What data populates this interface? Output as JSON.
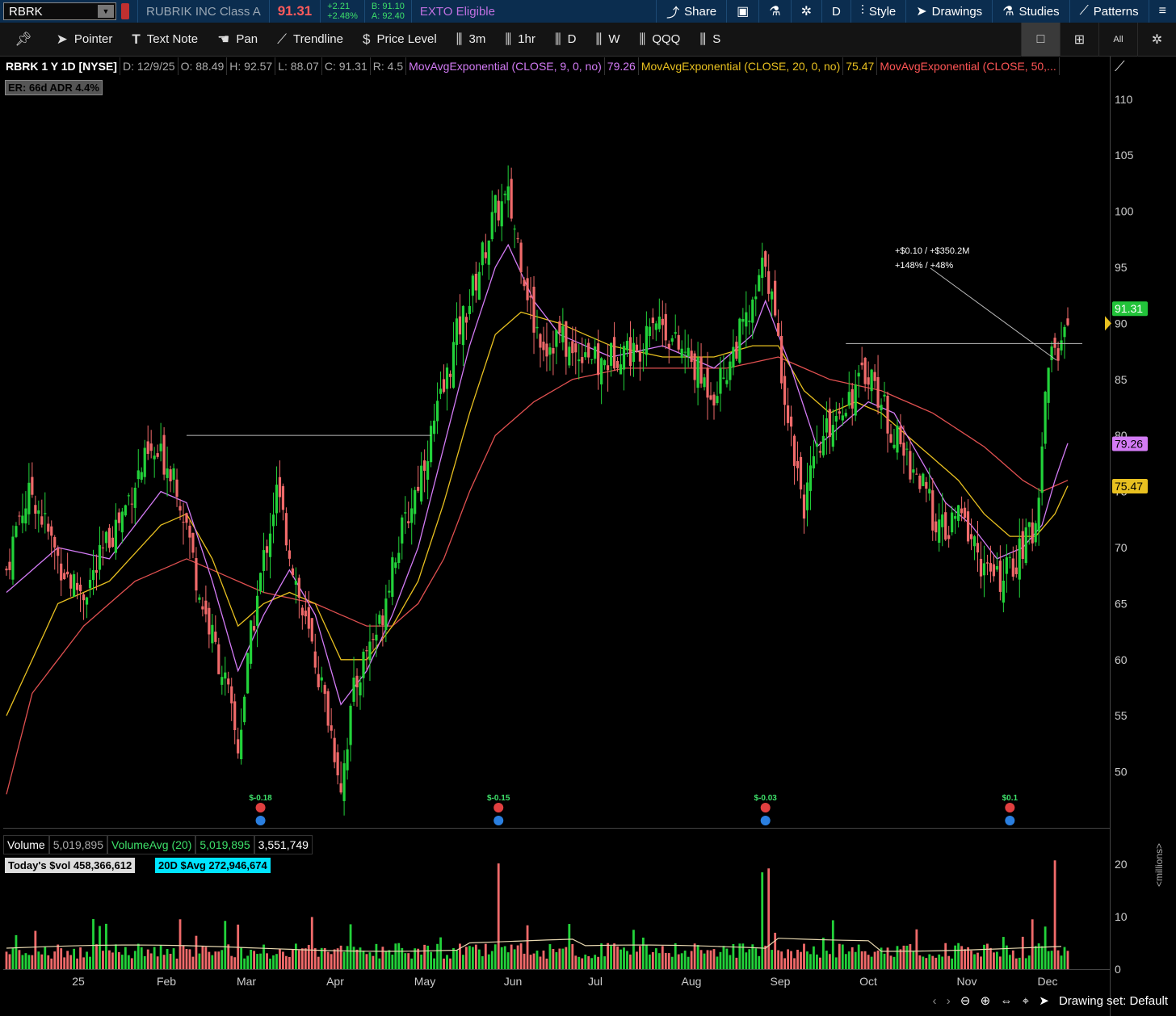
{
  "topbar": {
    "symbol": "RBRK",
    "company": "RUBRIK INC Class A",
    "last": "91.31",
    "change": "+2.21",
    "change_pct": "+2.48%",
    "bid": "B: 91.10",
    "ask": "A: 92.40",
    "exto": "EXTO Eligible",
    "share": "Share",
    "period": "D",
    "style": "Style",
    "drawings": "Drawings",
    "studies": "Studies",
    "patterns": "Patterns"
  },
  "toolbar": {
    "pointer": "Pointer",
    "text_note": "Text Note",
    "pan": "Pan",
    "trendline": "Trendline",
    "price_level": "Price Level",
    "t3m": "3m",
    "t1hr": "1hr",
    "tD": "D",
    "tW": "W",
    "tQQQ": "QQQ",
    "tS": "S"
  },
  "infobar": {
    "symbol": "RBRK 1 Y 1D [NYSE]",
    "date": "D: 12/9/25",
    "open": "O: 88.49",
    "high": "H: 92.57",
    "low": "L: 88.07",
    "close": "C: 91.31",
    "range": "R: 4.5",
    "ema9": "MovAvgExponential (CLOSE, 9, 0, no)",
    "ema9_val": "79.26",
    "ema20": "MovAvgExponential (CLOSE, 20, 0, no)",
    "ema20_val": "75.47",
    "ema50": "MovAvgExponential (CLOSE, 50,..."
  },
  "badges": {
    "er": "ER: 66d",
    "adr": "ADR 4.4%"
  },
  "annotation": {
    "line1": "+$0.10 / +$350.2M",
    "line2": "+148% / +48%"
  },
  "price_labels": {
    "last": "91.31",
    "ema9": "79.26",
    "ema20": "75.47"
  },
  "earnings": [
    "$-0.18",
    "$-0.15",
    "$-0.03",
    "$0.1"
  ],
  "volume": {
    "label": "Volume",
    "value": "5,019,895",
    "avg_label": "VolumeAvg (20)",
    "avg_value": "5,019,895",
    "other": "3,551,749",
    "todays": "Today's $vol 458,366,612",
    "avg20": "20D $Avg 272,946,674",
    "units": "<millions>"
  },
  "status": {
    "drawing_set": "Drawing set: Default"
  },
  "colors": {
    "up": "#22d23a",
    "down": "#f06a6a",
    "ema9": "#d37bf5",
    "ema20": "#e8c020",
    "ema50": "#e05050"
  },
  "chart_data": {
    "type": "candlestick",
    "ylim": [
      45,
      112
    ],
    "y_ticks": [
      50,
      55,
      60,
      65,
      70,
      75,
      80,
      85,
      90,
      95,
      100,
      105,
      110
    ],
    "volume_ticks": [
      0,
      10,
      20
    ],
    "x_labels": [
      "25",
      "Feb",
      "Mar",
      "Apr",
      "May",
      "Jun",
      "Jul",
      "Aug",
      "Sep",
      "Oct",
      "Nov",
      "Dec"
    ],
    "close_path": [
      [
        0,
        68
      ],
      [
        4,
        73
      ],
      [
        8,
        75
      ],
      [
        12,
        72
      ],
      [
        16,
        69
      ],
      [
        20,
        67
      ],
      [
        24,
        66
      ],
      [
        28,
        68
      ],
      [
        32,
        71
      ],
      [
        36,
        73
      ],
      [
        40,
        76
      ],
      [
        44,
        78
      ],
      [
        48,
        78
      ],
      [
        52,
        77
      ],
      [
        56,
        72
      ],
      [
        60,
        66
      ],
      [
        64,
        62
      ],
      [
        68,
        58
      ],
      [
        72,
        52
      ],
      [
        76,
        62
      ],
      [
        80,
        69
      ],
      [
        84,
        75
      ],
      [
        88,
        70
      ],
      [
        92,
        64
      ],
      [
        96,
        60
      ],
      [
        100,
        55
      ],
      [
        104,
        49
      ],
      [
        108,
        57
      ],
      [
        112,
        61
      ],
      [
        116,
        63
      ],
      [
        120,
        69
      ],
      [
        124,
        72
      ],
      [
        128,
        76
      ],
      [
        132,
        80
      ],
      [
        136,
        84
      ],
      [
        140,
        89
      ],
      [
        144,
        92
      ],
      [
        148,
        96
      ],
      [
        152,
        100
      ],
      [
        156,
        101
      ],
      [
        160,
        96
      ],
      [
        164,
        90
      ],
      [
        168,
        88
      ],
      [
        172,
        89
      ],
      [
        176,
        87
      ],
      [
        180,
        88
      ],
      [
        184,
        86
      ],
      [
        188,
        87
      ],
      [
        192,
        88
      ],
      [
        196,
        87
      ],
      [
        200,
        91
      ],
      [
        204,
        90
      ],
      [
        208,
        88
      ],
      [
        212,
        87
      ],
      [
        216,
        85
      ],
      [
        220,
        84
      ],
      [
        224,
        86
      ],
      [
        228,
        89
      ],
      [
        232,
        91
      ],
      [
        236,
        96
      ],
      [
        240,
        88
      ],
      [
        244,
        80
      ],
      [
        248,
        74
      ],
      [
        252,
        78
      ],
      [
        256,
        81
      ],
      [
        260,
        83
      ],
      [
        264,
        84
      ],
      [
        268,
        86
      ],
      [
        272,
        83
      ],
      [
        276,
        80
      ],
      [
        280,
        78
      ],
      [
        284,
        76
      ],
      [
        288,
        73
      ],
      [
        292,
        71
      ],
      [
        296,
        73
      ],
      [
        300,
        71
      ],
      [
        304,
        68
      ],
      [
        308,
        67
      ],
      [
        312,
        68
      ],
      [
        316,
        70
      ],
      [
        320,
        72
      ],
      [
        324,
        87
      ],
      [
        328,
        88
      ],
      [
        330,
        91.3
      ]
    ],
    "ema9_path": [
      [
        0,
        66
      ],
      [
        16,
        70
      ],
      [
        32,
        69
      ],
      [
        48,
        75
      ],
      [
        56,
        74
      ],
      [
        64,
        67
      ],
      [
        72,
        59
      ],
      [
        80,
        64
      ],
      [
        88,
        68
      ],
      [
        96,
        64
      ],
      [
        104,
        56
      ],
      [
        112,
        59
      ],
      [
        120,
        64
      ],
      [
        128,
        70
      ],
      [
        136,
        79
      ],
      [
        144,
        88
      ],
      [
        152,
        95
      ],
      [
        156,
        97
      ],
      [
        164,
        92
      ],
      [
        172,
        89
      ],
      [
        188,
        87
      ],
      [
        204,
        88
      ],
      [
        220,
        86
      ],
      [
        232,
        89
      ],
      [
        236,
        92
      ],
      [
        244,
        86
      ],
      [
        252,
        79
      ],
      [
        260,
        81
      ],
      [
        268,
        83
      ],
      [
        276,
        82
      ],
      [
        284,
        78
      ],
      [
        292,
        74
      ],
      [
        300,
        72
      ],
      [
        308,
        69
      ],
      [
        316,
        70
      ],
      [
        322,
        72
      ],
      [
        326,
        76
      ],
      [
        330,
        79.3
      ]
    ],
    "ema20_path": [
      [
        0,
        55
      ],
      [
        16,
        65
      ],
      [
        32,
        67
      ],
      [
        48,
        72
      ],
      [
        56,
        73
      ],
      [
        64,
        69
      ],
      [
        72,
        63
      ],
      [
        80,
        65
      ],
      [
        88,
        66
      ],
      [
        96,
        65
      ],
      [
        104,
        60
      ],
      [
        112,
        60
      ],
      [
        120,
        63
      ],
      [
        128,
        67
      ],
      [
        136,
        74
      ],
      [
        144,
        82
      ],
      [
        152,
        89
      ],
      [
        160,
        91
      ],
      [
        172,
        90
      ],
      [
        188,
        88
      ],
      [
        204,
        87
      ],
      [
        220,
        87
      ],
      [
        232,
        88
      ],
      [
        240,
        88
      ],
      [
        248,
        84
      ],
      [
        256,
        82
      ],
      [
        264,
        83
      ],
      [
        272,
        82
      ],
      [
        280,
        80
      ],
      [
        288,
        78
      ],
      [
        296,
        76
      ],
      [
        304,
        73
      ],
      [
        312,
        71
      ],
      [
        320,
        71
      ],
      [
        326,
        73
      ],
      [
        330,
        75.5
      ]
    ],
    "ema50_path": [
      [
        0,
        48
      ],
      [
        8,
        57
      ],
      [
        24,
        63
      ],
      [
        40,
        67
      ],
      [
        56,
        69
      ],
      [
        64,
        68
      ],
      [
        80,
        66
      ],
      [
        96,
        65
      ],
      [
        112,
        63
      ],
      [
        120,
        63
      ],
      [
        128,
        65
      ],
      [
        136,
        69
      ],
      [
        144,
        75
      ],
      [
        152,
        80
      ],
      [
        164,
        83
      ],
      [
        176,
        85
      ],
      [
        192,
        86
      ],
      [
        208,
        86
      ],
      [
        224,
        86
      ],
      [
        240,
        87
      ],
      [
        248,
        86
      ],
      [
        256,
        85
      ],
      [
        272,
        84
      ],
      [
        288,
        82
      ],
      [
        304,
        79
      ],
      [
        316,
        76
      ],
      [
        322,
        75
      ],
      [
        330,
        76
      ]
    ]
  }
}
